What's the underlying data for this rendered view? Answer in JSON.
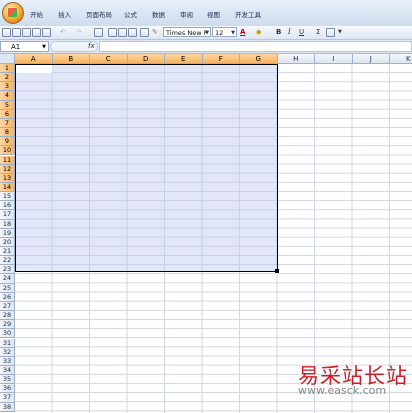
{
  "ribbon": {
    "tabs": [
      "开始",
      "插入",
      "页面布局",
      "公式",
      "数据",
      "审阅",
      "视图",
      "开发工具"
    ]
  },
  "toolbar": {
    "font_name": "Times New F",
    "font_size": "12",
    "bold": "B",
    "italic": "I",
    "underline": "U",
    "sum": "Σ",
    "font_color_glyph": "A"
  },
  "formula_bar": {
    "name_box": "A1",
    "fx_label": "fx",
    "formula": ""
  },
  "sheet": {
    "columns": [
      "A",
      "B",
      "C",
      "D",
      "E",
      "F",
      "G",
      "H",
      "I",
      "J",
      "K"
    ],
    "selected_columns": [
      "A",
      "B",
      "C",
      "D",
      "E",
      "F",
      "G"
    ],
    "rows": [
      "1",
      "2",
      "3",
      "4",
      "5",
      "6",
      "7",
      "8",
      "9",
      "10",
      "11",
      "12",
      "13",
      "14",
      "15",
      "16",
      "17",
      "18",
      "19",
      "20",
      "21",
      "22",
      "23",
      "24",
      "25",
      "26",
      "27",
      "28",
      "29",
      "30",
      "31",
      "32",
      "33",
      "34",
      "35",
      "36",
      "37",
      "38"
    ],
    "selected_rows_count": 14,
    "selection_range": "A1:G14"
  },
  "watermark": {
    "brand": "易采站长站",
    "url": "www.easck.com"
  },
  "colors": {
    "header_selected": "#f8b262",
    "selection_fill": "#c5cdec",
    "gridline": "#d0d7e5",
    "watermark_red": "#c8202a"
  }
}
